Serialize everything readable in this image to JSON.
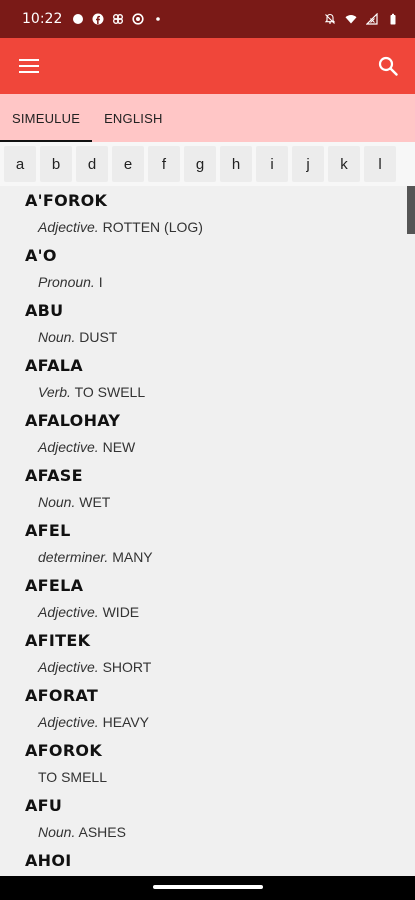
{
  "status": {
    "time": "10:22",
    "notif_icons": [
      "chat-bubble-icon",
      "facebook-icon",
      "apps-icon",
      "circle-record-icon",
      "dot-icon"
    ],
    "system_icons": [
      "mute-bell-icon",
      "wifi-icon",
      "signal-icon",
      "battery-icon"
    ]
  },
  "appbar": {
    "color": "#f0463a",
    "menu_icon": "hamburger-menu-icon",
    "search_icon": "search-icon"
  },
  "tabs": [
    {
      "label": "SIMEULUE",
      "active": true
    },
    {
      "label": "ENGLISH",
      "active": false
    }
  ],
  "letters": [
    "a",
    "b",
    "d",
    "e",
    "f",
    "g",
    "h",
    "i",
    "j",
    "k",
    "l"
  ],
  "entries": [
    {
      "word": "A'FOROK",
      "pos": "Adjective.",
      "meaning": "ROTTEN (LOG)"
    },
    {
      "word": "A'O",
      "pos": "Pronoun.",
      "meaning": "I"
    },
    {
      "word": "ABU",
      "pos": "Noun.",
      "meaning": "DUST"
    },
    {
      "word": "AFALA",
      "pos": "Verb.",
      "meaning": "TO SWELL"
    },
    {
      "word": "AFALOHAY",
      "pos": "Adjective.",
      "meaning": "NEW"
    },
    {
      "word": "AFASE",
      "pos": "Noun.",
      "meaning": "WET"
    },
    {
      "word": "AFEL",
      "pos": "determiner.",
      "meaning": "MANY"
    },
    {
      "word": "AFELA",
      "pos": "Adjective.",
      "meaning": "WIDE"
    },
    {
      "word": "AFITEK",
      "pos": "Adjective.",
      "meaning": "SHORT"
    },
    {
      "word": "AFORAT",
      "pos": "Adjective.",
      "meaning": "HEAVY"
    },
    {
      "word": "AFOROK",
      "pos": "",
      "meaning": "TO SMELL"
    },
    {
      "word": "AFU",
      "pos": "Noun.",
      "meaning": "ASHES"
    },
    {
      "word": "AHOI",
      "pos": "",
      "meaning": ""
    }
  ]
}
